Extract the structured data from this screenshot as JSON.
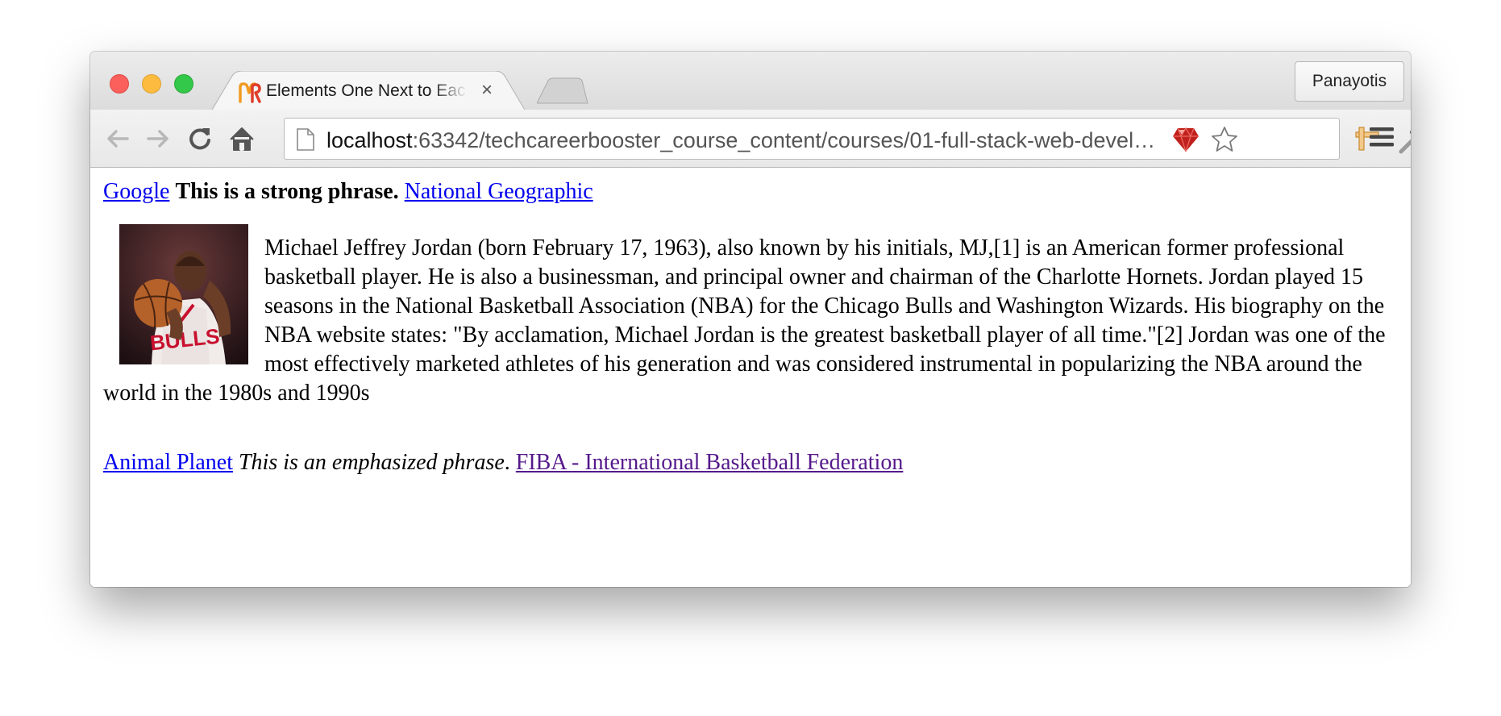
{
  "browser": {
    "tab_title": "Elements One Next to Each Other",
    "tab_close": "×",
    "profile_name": "Panayotis",
    "url_host": "localhost",
    "url_path": ":63342/techcareerbooster_course_content/courses/01-full-stack-web-developer/..."
  },
  "toolbar_icons": {
    "back": "back-arrow-icon",
    "forward": "forward-arrow-icon",
    "reload": "reload-icon",
    "home": "home-icon",
    "ruby": "ruby-extension-icon",
    "bookmark": "star-icon",
    "ext1": "ruler-extension-icon",
    "ext2": "eyedropper-extension-icon",
    "menu": "hamburger-menu-icon"
  },
  "page": {
    "line1": {
      "link_google": "Google",
      "strong_text": "This is a strong phrase.",
      "link_natgeo": "National Geographic"
    },
    "bio_text": "Michael Jeffrey Jordan (born February 17, 1963), also known by his initials, MJ,[1] is an American former professional basketball player. He is also a businessman, and principal owner and chairman of the Charlotte Hornets. Jordan played 15 seasons in the National Basketball Association (NBA) for the Chicago Bulls and Washington Wizards. His biography on the NBA website states: \"By acclamation, Michael Jordan is the greatest basketball player of all time.\"[2] Jordan was one of the most effectively marketed athletes of his generation and was considered instrumental in popularizing the NBA around the world in the 1980s and 1990s",
    "line3": {
      "link_animal": "Animal Planet",
      "em_text": "This is an emphasized phrase",
      "period": ".",
      "link_fiba": "FIBA - International Basketball Federation"
    }
  },
  "colors": {
    "link": "#0000ee",
    "visited_link": "#551a8b",
    "close_red": "#fc605c",
    "minimize_yellow": "#fdbc40",
    "zoom_green": "#34c84a"
  }
}
